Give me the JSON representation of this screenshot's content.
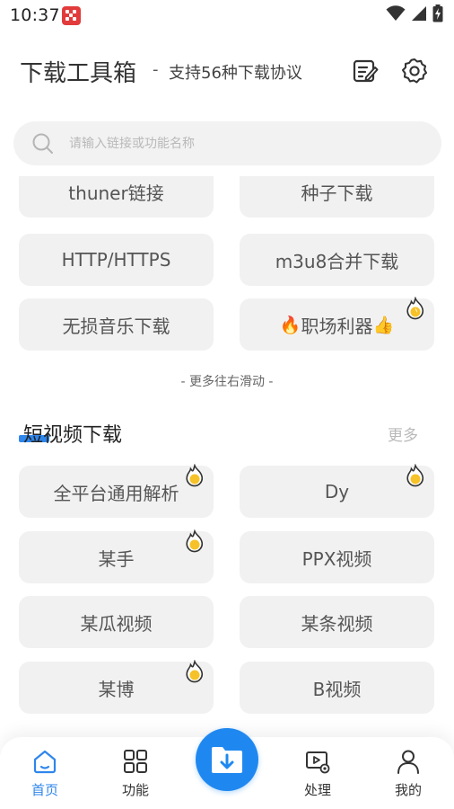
{
  "status_bar": {
    "time": "10:37",
    "icons": [
      "app-notification-icon",
      "wifi-icon",
      "signal-icon",
      "battery-charging-icon"
    ]
  },
  "header": {
    "title": "下载工具箱",
    "separator": "-",
    "subtitle": "支持56种下载协议",
    "icons": [
      "notes-edit-icon",
      "settings-gear-icon"
    ]
  },
  "search": {
    "placeholder": "请输入链接或功能名称",
    "value": ""
  },
  "download_tools": [
    {
      "label": "thuner链接",
      "hot": false
    },
    {
      "label": "种子下载",
      "hot": false
    },
    {
      "label": "HTTP/HTTPS",
      "hot": false
    },
    {
      "label": "m3u8合并下载",
      "hot": false
    },
    {
      "label": "无损音乐下载",
      "hot": false
    },
    {
      "label": "职场利器",
      "prefix_emoji": "🔥",
      "suffix_emoji": "👍",
      "hot": true
    }
  ],
  "scroll_hint": "- 更多往右滑动 -",
  "short_video": {
    "title": "短视频下载",
    "more_label": "更多",
    "accent_color": "#2f86eb",
    "items": [
      {
        "label": "全平台通用解析",
        "hot": true
      },
      {
        "label": "Dy",
        "hot": true
      },
      {
        "label": "某手",
        "hot": true
      },
      {
        "label": "PPX视频",
        "hot": false
      },
      {
        "label": "某瓜视频",
        "hot": false
      },
      {
        "label": "某条视频",
        "hot": false
      },
      {
        "label": "某博",
        "hot": true
      },
      {
        "label": "B视频",
        "hot": false
      }
    ]
  },
  "bottom_nav": {
    "items": [
      {
        "label": "首页",
        "icon": "home-icon",
        "active": true
      },
      {
        "label": "功能",
        "icon": "grid-icon",
        "active": false
      },
      {
        "label": "",
        "icon": "download-folder-icon",
        "active": false
      },
      {
        "label": "处理",
        "icon": "video-settings-icon",
        "active": false
      },
      {
        "label": "我的",
        "icon": "profile-icon",
        "active": false
      }
    ],
    "active_color": "#2f86eb",
    "fab_color": "#1f88f0"
  }
}
